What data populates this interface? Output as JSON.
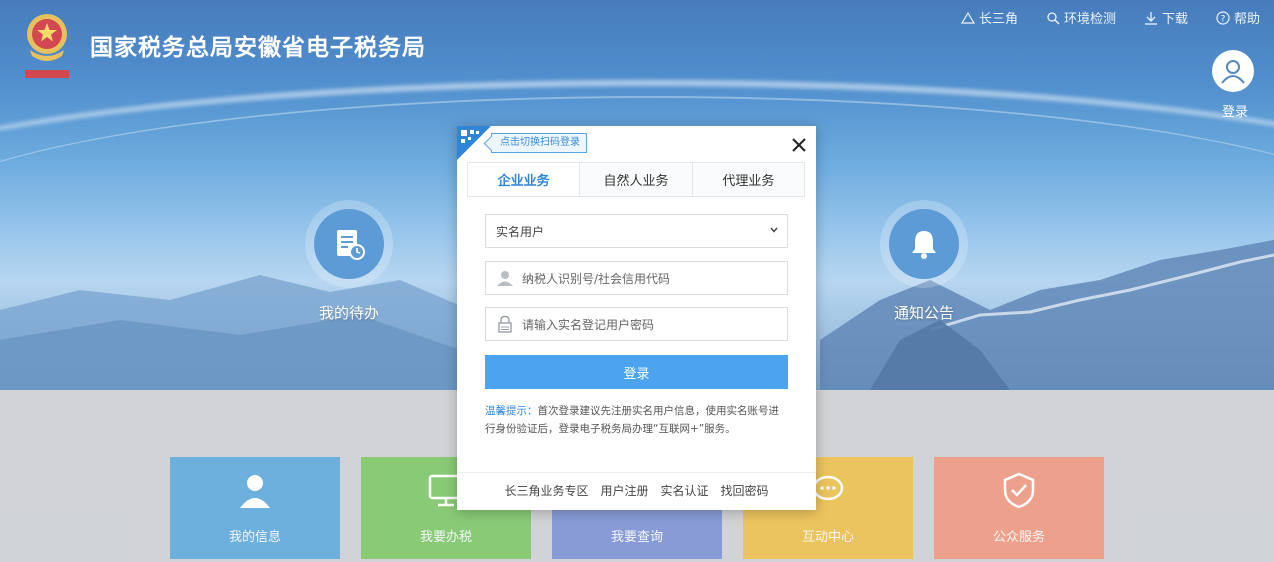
{
  "header": {
    "title": "国家税务总局安徽省电子税务局",
    "top_links": [
      {
        "label": "长三角",
        "icon": "triangle-icon"
      },
      {
        "label": "环境检测",
        "icon": "search-icon"
      },
      {
        "label": "下载",
        "icon": "download-icon"
      },
      {
        "label": "帮助",
        "icon": "help-icon"
      }
    ],
    "login_label": "登录"
  },
  "hero": {
    "left_item": {
      "label": "我的待办",
      "icon": "document-clock-icon"
    },
    "right_item": {
      "label": "通知公告",
      "icon": "bell-icon"
    }
  },
  "tiles": [
    {
      "label": "我的信息",
      "color": "#4e9fd6",
      "icon": "user-icon"
    },
    {
      "label": "我要办税",
      "color": "#6fbf5a",
      "icon": "monitor-icon"
    },
    {
      "label": "我要查询",
      "color": "#6f86cf",
      "icon": "search-icon"
    },
    {
      "label": "互动中心",
      "color": "#e8b83a",
      "icon": "chat-icon"
    },
    {
      "label": "公众服务",
      "color": "#e98c72",
      "icon": "service-icon"
    }
  ],
  "modal": {
    "qr_tip": "点击切换扫码登录",
    "tabs": [
      {
        "label": "企业业务",
        "active": true
      },
      {
        "label": "自然人业务",
        "active": false
      },
      {
        "label": "代理业务",
        "active": false
      }
    ],
    "user_type": {
      "value": "实名用户",
      "icon": "chevron-down-icon"
    },
    "tax_id": {
      "placeholder": "纳税人识别号/社会信用代码",
      "icon": "user-icon"
    },
    "password": {
      "placeholder": "请输入实名登记用户密码",
      "icon": "lock-icon"
    },
    "submit_label": "登录",
    "tips_label": "温馨提示：",
    "tips_text": "首次登录建议先注册实名用户信息，使用实名账号进行身份验证后，登录电子税务局办理“互联网+”服务。",
    "footer_links": [
      "长三角业务专区",
      "用户注册",
      "实名认证",
      "找回密码"
    ]
  },
  "colors": {
    "accent": "#4ca3ee",
    "tab_active": "#2f86d8"
  }
}
